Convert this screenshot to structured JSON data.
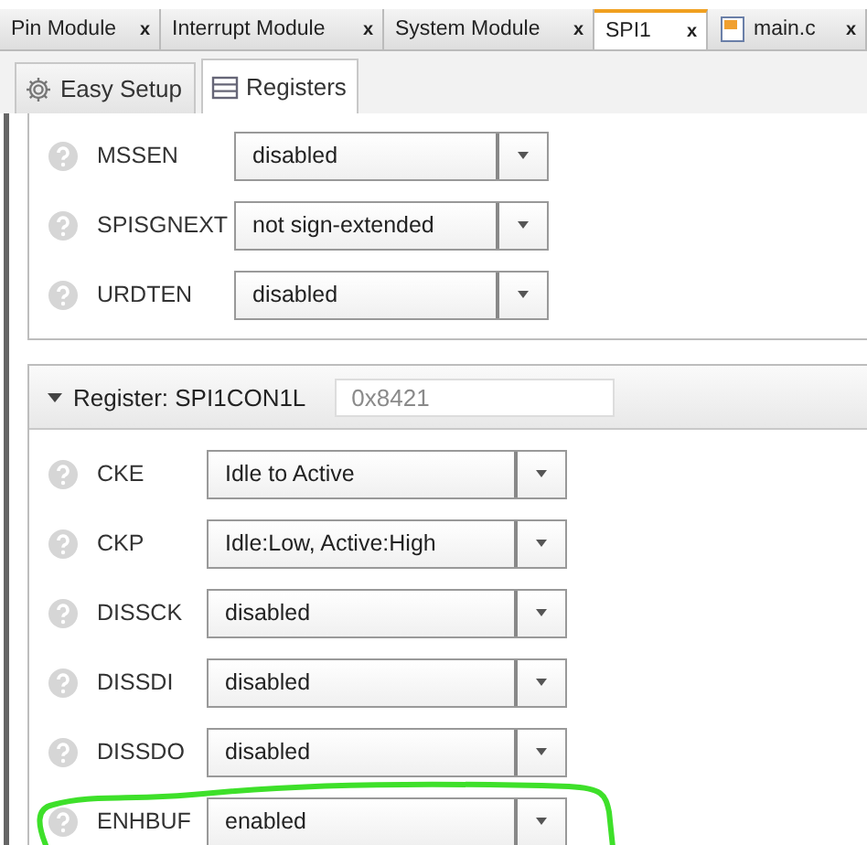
{
  "tabs": [
    {
      "label": "Pin Module",
      "close": "x",
      "selected": false,
      "kind": "plain"
    },
    {
      "label": "Interrupt Module",
      "close": "x",
      "selected": false,
      "kind": "plain"
    },
    {
      "label": "System Module",
      "close": "x",
      "selected": false,
      "kind": "plain"
    },
    {
      "label": "SPI1",
      "close": "x",
      "selected": true,
      "kind": "plain"
    },
    {
      "label": "main.c",
      "close": "x",
      "selected": false,
      "kind": "file"
    }
  ],
  "subtabs": [
    {
      "label": "Easy Setup",
      "selected": false,
      "kind": "gear"
    },
    {
      "label": "Registers",
      "selected": true,
      "kind": "list"
    }
  ],
  "groups": [
    {
      "rows": [
        {
          "name": "MSSEN",
          "value": "disabled",
          "highlighted": false
        },
        {
          "name": "SPISGNEXT",
          "value": "not sign-extended",
          "highlighted": false
        },
        {
          "name": "URDTEN",
          "value": "disabled",
          "highlighted": false
        }
      ]
    },
    {
      "title": "Register: SPI1CON1L",
      "value": "0x8421",
      "expanded": true,
      "rows": [
        {
          "name": "CKE",
          "value": "Idle to Active",
          "highlighted": false
        },
        {
          "name": "CKP",
          "value": "Idle:Low, Active:High",
          "highlighted": false
        },
        {
          "name": "DISSCK",
          "value": "disabled",
          "highlighted": false
        },
        {
          "name": "DISSDI",
          "value": "disabled",
          "highlighted": false
        },
        {
          "name": "DISSDO",
          "value": "disabled",
          "highlighted": false
        },
        {
          "name": "ENHBUF",
          "value": "enabled",
          "highlighted": true
        }
      ]
    }
  ]
}
